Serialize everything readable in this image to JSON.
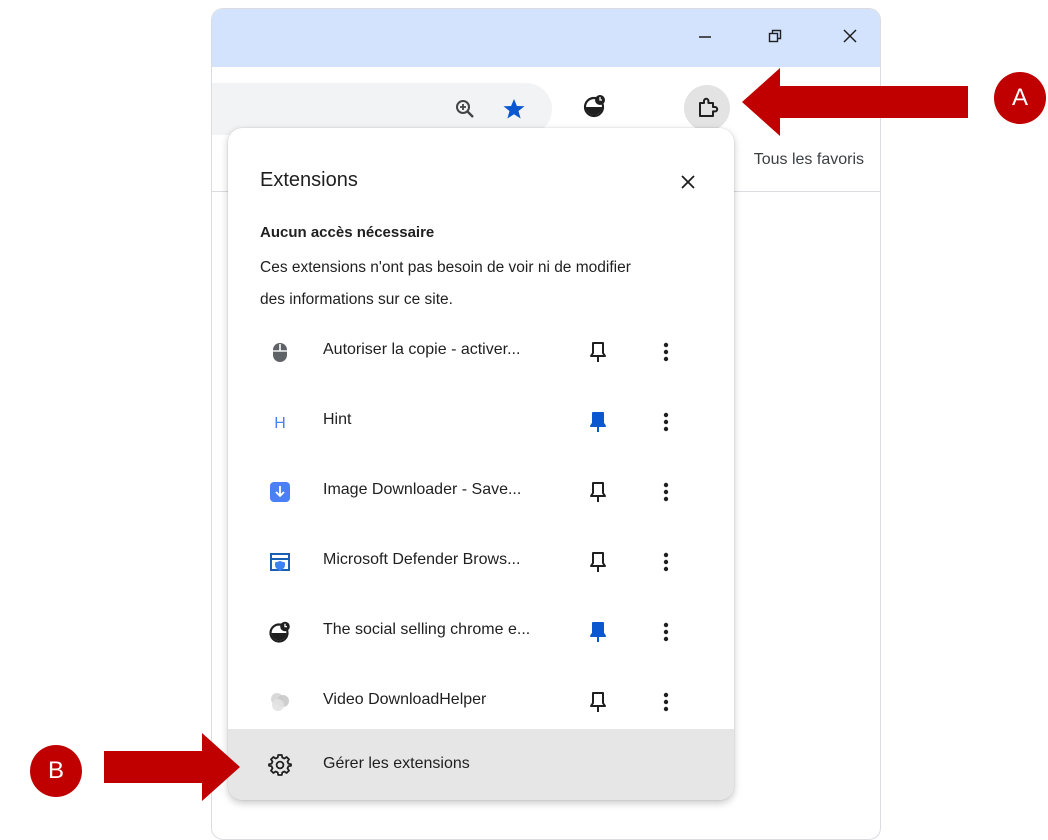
{
  "window": {
    "controls": {
      "minimize_icon": "minimize-icon",
      "restore_icon": "restore-icon",
      "close_icon": "close-icon"
    }
  },
  "toolbar": {
    "zoom_icon": "zoom-icon",
    "bookmark_star_icon": "star-icon",
    "social_ext_icon": "social-selling-icon",
    "extensions_icon": "puzzle-icon"
  },
  "bookmarks_bar": {
    "all_bookmarks": "Tous les favoris"
  },
  "popup": {
    "title": "Extensions",
    "section_heading": "Aucun accès nécessaire",
    "section_desc": "Ces extensions n'ont pas besoin de voir ni de modifier des informations sur ce site.",
    "extensions": [
      {
        "name": "Autoriser la copie - activer...",
        "icon": "mouse-icon",
        "pinned": false
      },
      {
        "name": "Hint",
        "icon": "hint-h-icon",
        "pinned": true
      },
      {
        "name": "Image Downloader - Save...",
        "icon": "download-icon",
        "pinned": false
      },
      {
        "name": "Microsoft Defender Brows...",
        "icon": "defender-icon",
        "pinned": false
      },
      {
        "name": "The social selling chrome e...",
        "icon": "social-selling-icon",
        "pinned": true
      },
      {
        "name": "Video DownloadHelper",
        "icon": "video-helper-icon",
        "pinned": false
      }
    ],
    "manage_label": "Gérer les extensions"
  },
  "callouts": {
    "a": "A",
    "b": "B"
  },
  "colors": {
    "accent": "#0b57d0",
    "callout": "#c00000",
    "titlebar": "#d3e3fd"
  }
}
